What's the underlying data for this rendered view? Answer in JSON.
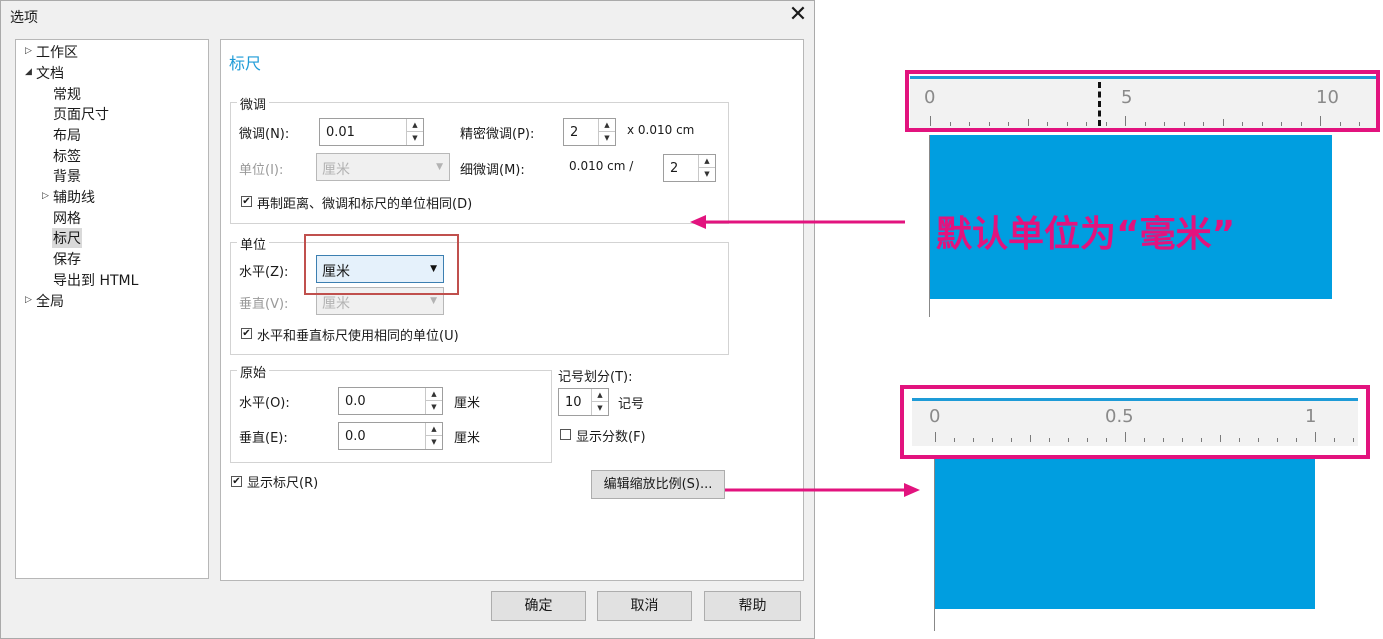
{
  "dialog": {
    "title": "选项",
    "close_glyph": "✕",
    "tree": {
      "items": [
        {
          "label": "工作区",
          "expanded": false
        },
        {
          "label": "文档",
          "expanded": true
        },
        {
          "label": "常规"
        },
        {
          "label": "页面尺寸"
        },
        {
          "label": "布局"
        },
        {
          "label": "标签"
        },
        {
          "label": "背景"
        },
        {
          "label": "辅助线",
          "expanded": false
        },
        {
          "label": "网格"
        },
        {
          "label": "标尺",
          "selected": true
        },
        {
          "label": "保存"
        },
        {
          "label": "导出到 HTML"
        },
        {
          "label": "全局",
          "expanded": false
        }
      ]
    },
    "panel": {
      "title": "标尺",
      "nudge": {
        "group_label": "微调",
        "nudge_label": "微调(N):",
        "nudge_value": "0.01",
        "units_label": "单位(I):",
        "units_value": "厘米",
        "super_nudge_label": "精密微调(P):",
        "super_nudge_value": "2",
        "super_nudge_suffix": "x 0.010 cm",
        "micro_nudge_label": "细微调(M):",
        "micro_nudge_prefix": "0.010 cm /",
        "micro_nudge_value": "2",
        "same_units_label": "再制距离、微调和标尺的单位相同(D)",
        "same_units_checked": true
      },
      "units": {
        "group_label": "单位",
        "horizontal_label": "水平(Z):",
        "horizontal_value": "厘米",
        "vertical_label": "垂直(V):",
        "vertical_value": "厘米",
        "same_units_label": "水平和垂直标尺使用相同的单位(U)",
        "same_units_checked": true
      },
      "origin": {
        "group_label": "原始",
        "horizontal_label": "水平(O):",
        "horizontal_value": "0.0",
        "horizontal_unit": "厘米",
        "vertical_label": "垂直(E):",
        "vertical_value": "0.0",
        "vertical_unit": "厘米"
      },
      "ticks": {
        "label": "记号划分(T):",
        "value": "10",
        "unit": "记号",
        "show_fractions_label": "显示分数(F)",
        "show_fractions_checked": false
      },
      "show_rulers_label": "显示标尺(R)",
      "show_rulers_checked": true,
      "edit_scale_button": "编辑缩放比例(S)..."
    },
    "buttons": {
      "ok": "确定",
      "cancel": "取消",
      "help": "帮助"
    }
  },
  "annotation": {
    "callout_text": "默认单位为“毫米”",
    "ruler_top": {
      "labels": [
        "0",
        "5",
        "10"
      ]
    },
    "ruler_bottom": {
      "labels": [
        "0",
        "0.5",
        "1"
      ]
    },
    "accent_color": "#e2137e",
    "fill_color": "#009ee0"
  }
}
